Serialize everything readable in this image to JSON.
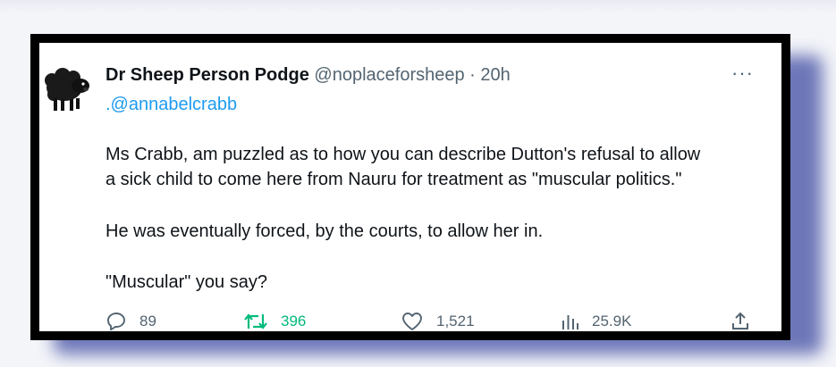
{
  "tweet": {
    "author_name": "Dr Sheep Person Podge",
    "handle": "@noplaceforsheep",
    "separator": "·",
    "time": "20h",
    "more": "···",
    "mention": ".@annabelcrabb",
    "paragraphs": [
      "Ms Crabb, am puzzled as to how you can describe Dutton's refusal to allow",
      "a sick child to come here from Nauru for treatment as \"muscular politics.\"",
      "He was eventually forced, by the courts, to allow her in.",
      "\"Muscular\" you say?"
    ],
    "actions": {
      "replies": "89",
      "retweets": "396",
      "likes": "1,521",
      "views": "25.9K"
    }
  },
  "colors": {
    "text": "#0f1419",
    "muted": "#536471",
    "link": "#1d9bf0",
    "retweet": "#00ba7c",
    "shadow": "#5661ad"
  },
  "icons": [
    "sheep-avatar-icon",
    "more-icon",
    "reply-icon",
    "retweet-icon",
    "like-icon",
    "views-icon",
    "share-icon"
  ]
}
